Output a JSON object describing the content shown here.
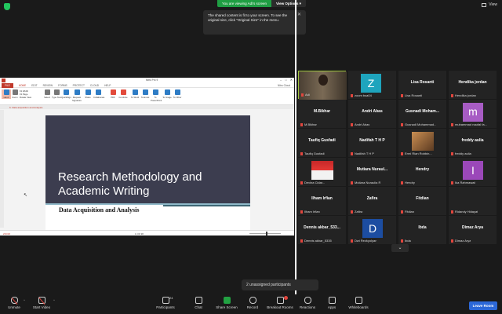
{
  "top_bar": {
    "viewing_label": "You are viewing Adi's screen",
    "view_options": "View Options",
    "view_button": "View"
  },
  "tooltip": {
    "text": "The shared content is fit to your screen. To see the original size, click \"Original Size\" in the menu."
  },
  "shared_app": {
    "window_title": "Nitro Pro 9",
    "tabs": [
      "FILE",
      "HOME",
      "EDIT",
      "REVIEW",
      "FORMS",
      "PROTECT",
      "CLOUD",
      "HELP"
    ],
    "user_label": "Nitro Cloud",
    "ribbon": {
      "hand": "Hand",
      "zoom": "Zoom",
      "fit_width": "Fit Width",
      "fit_page": "Fit Page",
      "rotate_view": "Rotate View",
      "select": "Select",
      "type_text": "Type Text",
      "quicksign": "QuickSign",
      "request_signature": "Request Signature",
      "share": "Share",
      "collaborate": "Collaborate",
      "pdf": "PDF",
      "combine": "Combine",
      "to_word": "To Word",
      "to_excel": "To Excel",
      "to_powerpoint": "To PowerPoint",
      "to_image": "To Image",
      "to_other": "To Other"
    },
    "doc_tab": "6. Data acquisition and Analysis",
    "slide": {
      "title": "Research Methodology and Academic Writing",
      "subtitle": "Data Acquisition and Analysis"
    },
    "status_left": "ZOOM",
    "page_indicator": "1 OF 38"
  },
  "participants": [
    {
      "name": "",
      "label": "Adi",
      "type": "video"
    },
    {
      "name": "",
      "label": "zoom bsa04",
      "type": "avatar",
      "letter": "Z"
    },
    {
      "name": "Lisa Rosanti",
      "label": "Lisa Rosanti",
      "type": "name"
    },
    {
      "name": "Hendika jordan",
      "label": "Hendika jordan",
      "type": "name"
    },
    {
      "name": "M.Bikhar",
      "label": "M.Bikhar",
      "type": "name"
    },
    {
      "name": "Andri Abas",
      "label": "Andri Abas",
      "type": "name"
    },
    {
      "name": "Gusnadi Moham...",
      "label": "Gusnadi Mohammad...",
      "type": "name"
    },
    {
      "name": "",
      "label": "muhammad naufal fa...",
      "type": "avatar",
      "letter": "m"
    },
    {
      "name": "Taufiq Gusfadi",
      "label": "Taufiq Gusfadi",
      "type": "name"
    },
    {
      "name": "Nadifah T H P",
      "label": "Nadifah T H P",
      "type": "name"
    },
    {
      "name": "",
      "label": "Ermi Rian Robbin...",
      "type": "photo"
    },
    {
      "name": "freddy aulia",
      "label": "freddy aulia",
      "type": "name"
    },
    {
      "name": "",
      "label": "Devina Cidar...",
      "type": "photo"
    },
    {
      "name": "Mutiara Nuraul...",
      "label": "Mutiara Nuraulia R",
      "type": "name"
    },
    {
      "name": "Hendry",
      "label": "Hendry",
      "type": "name"
    },
    {
      "name": "",
      "label": "Ika Rahmawati",
      "type": "avatar",
      "letter": "I"
    },
    {
      "name": "Ilham Irfian",
      "label": "Ilham Irfian",
      "type": "name"
    },
    {
      "name": "Zafira",
      "label": "Zafira",
      "type": "name"
    },
    {
      "name": "Fitdian",
      "label": "Fitdian",
      "type": "name"
    },
    {
      "name": "",
      "label": "Ridandy Hidayat",
      "type": "name"
    },
    {
      "name": "Dennis akbar_533...",
      "label": "Dennis akbar_5335",
      "type": "name"
    },
    {
      "name": "",
      "label": "Dwi Rezkyolyan",
      "type": "avatar",
      "letter": "D"
    },
    {
      "name": "Ibda",
      "label": "Ibda",
      "type": "name"
    },
    {
      "name": "Dimaz Arya",
      "label": "Dimaz Arya",
      "type": "name"
    }
  ],
  "breakout_notice": "2 unassigned participants",
  "toolbar": {
    "unmute": "Unmute",
    "start_video": "Start Video",
    "participants": "Participants",
    "participant_count": "24",
    "chat": "Chat",
    "share_screen": "Share Screen",
    "record": "Record",
    "breakout_rooms": "Breakout Rooms",
    "reactions": "Reactions",
    "apps": "Apps",
    "whiteboards": "Whiteboards",
    "leave": "Leave Room"
  },
  "colors": {
    "accent_green": "#22a142",
    "leave_blue": "#2c68d8",
    "mute_red": "#e0463e",
    "slide_dark": "#3c3d4f"
  }
}
